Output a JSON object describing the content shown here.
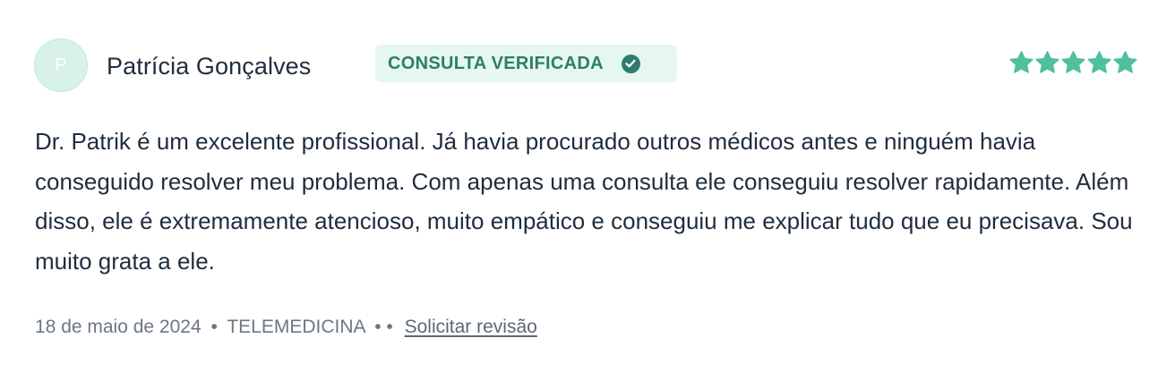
{
  "reviewer": {
    "initial": "P",
    "name": "Patrícia Gonçalves"
  },
  "badge": {
    "label": "CONSULTA VERIFICADA",
    "icon": "check-circle-icon",
    "color": "#2e7d6a",
    "background": "#e6f6f1"
  },
  "rating": {
    "value": 5,
    "max": 5,
    "color": "#4fbf9f"
  },
  "review": {
    "text": "Dr. Patrik é um excelente profissional. Já havia procurado outros médicos antes e ninguém havia conseguido resolver meu problema. Com apenas uma consulta ele conseguiu resolver rapidamente. Além disso, ele é extremamente atencioso, muito empático e conseguiu me explicar tudo que eu precisava. Sou muito grata a ele."
  },
  "meta": {
    "date": "18 de maio de 2024",
    "separator": "•",
    "type": "TELEMEDICINA",
    "extra_separator": "• •",
    "request_review_label": "Solicitar revisão"
  }
}
